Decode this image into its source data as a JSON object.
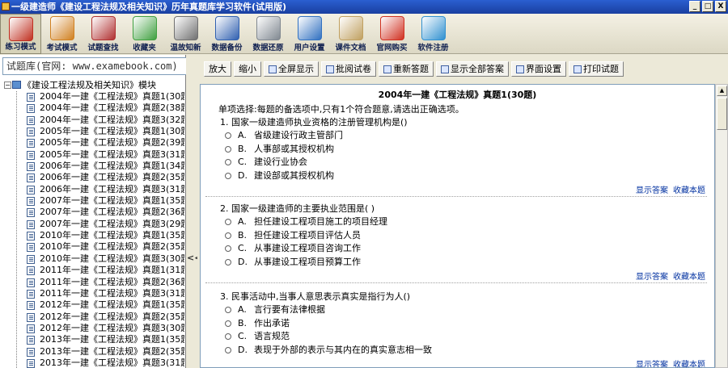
{
  "window": {
    "title": "一级建造师《建设工程法规及相关知识》历年真题库学习软件(试用版)",
    "buttons": [
      "_",
      "□",
      "X"
    ]
  },
  "toolbar": {
    "items": [
      {
        "label": "练习模式",
        "icon": "books-icon",
        "color": "#c03020"
      },
      {
        "label": "考试模式",
        "icon": "clock-icon",
        "color": "#d08020"
      },
      {
        "label": "试题查找",
        "icon": "magnifier-icon",
        "color": "#b03030"
      },
      {
        "label": "收藏夹",
        "icon": "favorites-icon",
        "color": "#40a040"
      },
      {
        "label": "温故知新",
        "icon": "notebook-icon",
        "color": "#707070"
      },
      {
        "label": "数据备份",
        "icon": "backup-disc-icon",
        "color": "#3060b0"
      },
      {
        "label": "数据还原",
        "icon": "restore-icon",
        "color": "#808890"
      },
      {
        "label": "用户设置",
        "icon": "user-settings-icon",
        "color": "#3070c0"
      },
      {
        "label": "课件文档",
        "icon": "document-icon",
        "color": "#c0a060"
      },
      {
        "label": "官网购买",
        "icon": "browser-icon",
        "color": "#d03020"
      },
      {
        "label": "软件注册",
        "icon": "register-users-icon",
        "color": "#3090d0"
      }
    ]
  },
  "sidebar": {
    "search_text": "试题库(官网: www.examebook.com)",
    "root_label": "《建设工程法规及相关知识》模块",
    "items": [
      "2004年一建《工程法规》真题1(30题)",
      "2004年一建《工程法规》真题2(38题)",
      "2004年一建《工程法规》真题3(32题)",
      "2005年一建《工程法规》真题1(30题)",
      "2005年一建《工程法规》真题2(39题)",
      "2005年一建《工程法规》真题3(31题)",
      "2006年一建《工程法规》真题1(34题)",
      "2006年一建《工程法规》真题2(35题)",
      "2006年一建《工程法规》真题3(31题)",
      "2007年一建《工程法规》真题1(35题)",
      "2007年一建《工程法规》真题2(36题)",
      "2007年一建《工程法规》真题3(29题)",
      "2010年一建《工程法规》真题1(35题)",
      "2010年一建《工程法规》真题2(35题)",
      "2010年一建《工程法规》真题3(30题)",
      "2011年一建《工程法规》真题1(31题)",
      "2011年一建《工程法规》真题2(36题)",
      "2011年一建《工程法规》真题3(31题)",
      "2012年一建《工程法规》真题1(35题)",
      "2012年一建《工程法规》真题2(35题)",
      "2012年一建《工程法规》真题3(30题)",
      "2013年一建《工程法规》真题1(35题)",
      "2013年一建《工程法规》真题2(35题)",
      "2013年一建《工程法规》真题3(31题)"
    ]
  },
  "splitter": {
    "arrow": "<<"
  },
  "action_buttons": [
    {
      "label": "放大",
      "icon": false
    },
    {
      "label": "缩小",
      "icon": false
    },
    {
      "label": "全屏显示",
      "icon": true
    },
    {
      "label": "批阅试卷",
      "icon": true
    },
    {
      "label": "重新答题",
      "icon": true
    },
    {
      "label": "显示全部答案",
      "icon": true
    },
    {
      "label": "界面设置",
      "icon": true
    },
    {
      "label": "打印试题",
      "icon": true
    }
  ],
  "paper": {
    "title": "2004年一建《工程法规》真题1(30题)",
    "instruction": "单项选择:每题的备选项中,只有1个符合题意,请选出正确选项。",
    "show_answer": "显示答案",
    "favorite": "收藏本题",
    "questions": [
      {
        "text": "1. 国家一级建造师执业资格的注册管理机构是()",
        "options": [
          {
            "letter": "A.",
            "text": "省级建设行政主管部门"
          },
          {
            "letter": "B.",
            "text": "人事部或其授权机构"
          },
          {
            "letter": "C.",
            "text": "建设行业协会"
          },
          {
            "letter": "D.",
            "text": "建设部或其授权机构"
          }
        ]
      },
      {
        "text": "2. 国家一级建造师的主要执业范围是( )",
        "options": [
          {
            "letter": "A.",
            "text": "担任建设工程项目施工的项目经理"
          },
          {
            "letter": "B.",
            "text": "担任建设工程项目评估人员"
          },
          {
            "letter": "C.",
            "text": "从事建设工程项目咨询工作"
          },
          {
            "letter": "D.",
            "text": "从事建设工程项目预算工作"
          }
        ]
      },
      {
        "text": "3. 民事活动中,当事人意思表示真实是指行为人()",
        "options": [
          {
            "letter": "A.",
            "text": "言行要有法律根据"
          },
          {
            "letter": "B.",
            "text": "作出承诺"
          },
          {
            "letter": "C.",
            "text": "语言规范"
          },
          {
            "letter": "D.",
            "text": "表现于外部的表示与其内在的真实意志相一致"
          }
        ]
      }
    ]
  }
}
